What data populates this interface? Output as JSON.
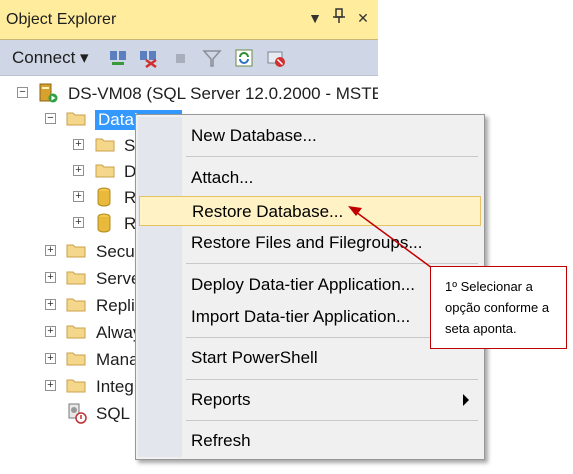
{
  "window": {
    "title": "Object Explorer",
    "controls": [
      "▼",
      "⊓",
      "✕"
    ]
  },
  "toolbar": {
    "connect_label": "Connect ▾",
    "icons": [
      "connect-object-explorer-icon",
      "disconnect-icon",
      "stop-icon",
      "filter-icon",
      "refresh-icon",
      "summary-icon"
    ]
  },
  "tree": {
    "server": "DS-VM08 (SQL Server 12.0.2000 - MSTE",
    "databases": "Databases",
    "child_rows": [
      "Sy",
      "D",
      "R",
      "R"
    ],
    "sibling_rows": [
      "Secur",
      "Serve",
      "Repli",
      "Alway",
      "Mana",
      "Integ"
    ],
    "agent": "SQL S"
  },
  "menu": {
    "items": [
      {
        "label": "New Database..."
      },
      {
        "label": "Attach..."
      },
      {
        "label": "Restore Database..."
      },
      {
        "label": "Restore Files and Filegroups..."
      },
      {
        "label": "Deploy Data-tier Application..."
      },
      {
        "label": "Import Data-tier Application..."
      },
      {
        "label": "Start PowerShell"
      },
      {
        "label": "Reports"
      },
      {
        "label": "Refresh"
      }
    ]
  },
  "callout": {
    "text": "1º Selecionar a opção conforme a seta aponta."
  },
  "colors": {
    "title_bar": "#ffed9d",
    "toolbar": "#cfd6e5",
    "selection": "#3399ff",
    "menu_highlight": "#fff2c4",
    "callout_border": "#c00000"
  }
}
